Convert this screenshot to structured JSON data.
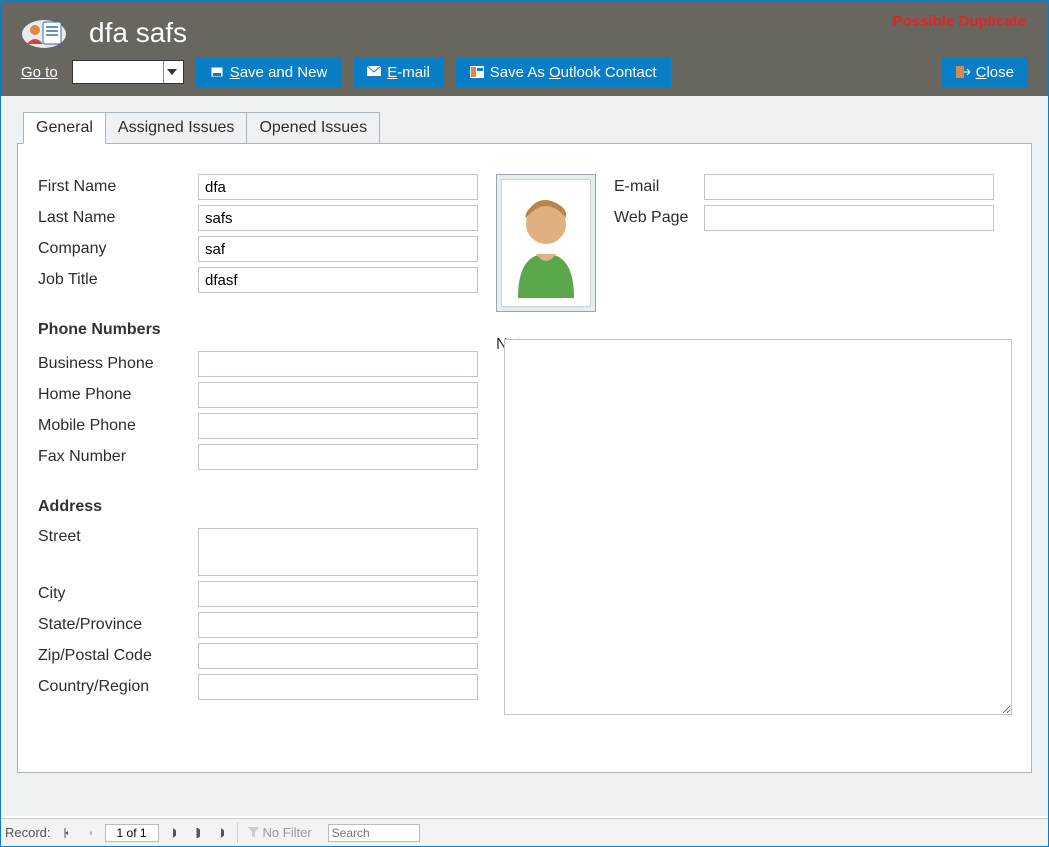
{
  "header": {
    "title": "dfa safs",
    "warning": "Possible Duplicate",
    "goto_label": "Go to"
  },
  "toolbar": {
    "save_new": "Save and New",
    "save_new_u": "S",
    "email": "E-mail",
    "email_u": "E",
    "save_outlook_pre": "Save As ",
    "save_outlook_u": "O",
    "save_outlook_post": "utlook Contact",
    "close": "Close",
    "close_u": "C"
  },
  "tabs": {
    "general": "General",
    "assigned": "Assigned Issues",
    "opened": "Opened Issues"
  },
  "form": {
    "first_name_lbl": "First Name",
    "first_name": "dfa",
    "last_name_lbl": "Last Name",
    "last_name": "safs",
    "company_lbl": "Company",
    "company": "saf",
    "job_title_lbl": "Job Title",
    "job_title": "dfasf",
    "phone_section": "Phone Numbers",
    "business_phone_lbl": "Business Phone",
    "business_phone": "",
    "home_phone_lbl": "Home Phone",
    "home_phone": "",
    "mobile_phone_lbl": "Mobile Phone",
    "mobile_phone": "",
    "fax_lbl": "Fax Number",
    "fax": "",
    "address_section": "Address",
    "street_lbl": "Street",
    "street": "",
    "city_lbl": "City",
    "city": "",
    "state_lbl": "State/Province",
    "state": "",
    "zip_lbl": "Zip/Postal Code",
    "zip": "",
    "country_lbl": "Country/Region",
    "country": "",
    "email_lbl": "E-mail",
    "email": "",
    "web_lbl": "Web Page",
    "web": "",
    "notes_lbl": "Notes",
    "notes": ""
  },
  "status": {
    "record_lbl": "Record:",
    "pos": "1 of 1",
    "nofilter": "No Filter",
    "search_placeholder": "Search"
  }
}
